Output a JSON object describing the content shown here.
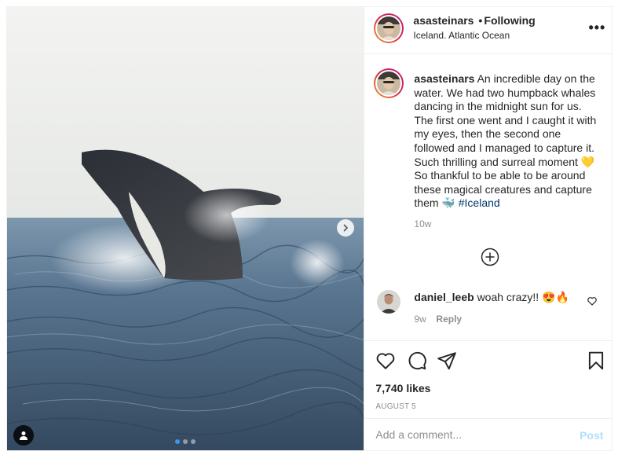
{
  "header": {
    "username": "asasteinars",
    "separator": "•",
    "follow_status": "Following",
    "location": "Iceland. Atlantic Ocean",
    "more_label": "•••"
  },
  "caption": {
    "username": "asasteinars",
    "text": "An incredible day on the water. We had two humpback whales dancing in the midnight sun for us. The first one went and I caught it with my eyes, then the second one followed and I managed to capture it. Such thrilling and surreal moment 💛 So thankful to be able to be around these magical creatures and capture them 🐳 ",
    "hashtag": "#Iceland",
    "time": "10w"
  },
  "comments": [
    {
      "username": "daniel_leeb",
      "text": "woah crazy!! 😍🔥",
      "time": "9w",
      "reply_label": "Reply"
    }
  ],
  "stats": {
    "likes": "7,740 likes",
    "date": "AUGUST 5"
  },
  "composer": {
    "placeholder": "Add a comment...",
    "post_label": "Post"
  },
  "carousel": {
    "slide_count": 3,
    "active_index": 0
  },
  "icons": [
    "next-arrow-icon",
    "user-tag-icon",
    "more-options-icon",
    "load-more-comments-icon",
    "heart-icon",
    "comment-icon",
    "share-icon",
    "bookmark-icon"
  ],
  "colors": {
    "link": "#00376b",
    "muted": "#8e8e8e",
    "post_disabled": "#b2dffc",
    "carousel_active": "#3897f0"
  }
}
